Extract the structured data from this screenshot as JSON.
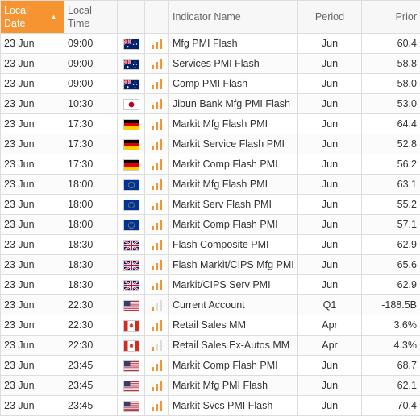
{
  "header": {
    "date": "Local Date",
    "time": "Local Time",
    "name": "Indicator Name",
    "period": "Period",
    "prior": "Prior"
  },
  "colors": {
    "accent": "#f79432",
    "bar_inactive": "#dddddd"
  },
  "rows": [
    {
      "date": "23 Jun",
      "time": "09:00",
      "flag": "AU",
      "name": "Mfg PMI Flash",
      "period": "Jun",
      "prior": "60.4",
      "importance": 3
    },
    {
      "date": "23 Jun",
      "time": "09:00",
      "flag": "AU",
      "name": "Services PMI Flash",
      "period": "Jun",
      "prior": "58.8",
      "importance": 3
    },
    {
      "date": "23 Jun",
      "time": "09:00",
      "flag": "AU",
      "name": "Comp PMI Flash",
      "period": "Jun",
      "prior": "58.0",
      "importance": 3
    },
    {
      "date": "23 Jun",
      "time": "10:30",
      "flag": "JP",
      "name": "Jibun Bank Mfg PMI Flash",
      "period": "Jun",
      "prior": "53.0",
      "importance": 3
    },
    {
      "date": "23 Jun",
      "time": "17:30",
      "flag": "DE",
      "name": "Markit Mfg Flash PMI",
      "period": "Jun",
      "prior": "64.4",
      "importance": 3
    },
    {
      "date": "23 Jun",
      "time": "17:30",
      "flag": "DE",
      "name": "Markit Service Flash PMI",
      "period": "Jun",
      "prior": "52.8",
      "importance": 3
    },
    {
      "date": "23 Jun",
      "time": "17:30",
      "flag": "DE",
      "name": "Markit Comp Flash PMI",
      "period": "Jun",
      "prior": "56.2",
      "importance": 3
    },
    {
      "date": "23 Jun",
      "time": "18:00",
      "flag": "EU",
      "name": "Markit Mfg Flash PMI",
      "period": "Jun",
      "prior": "63.1",
      "importance": 3
    },
    {
      "date": "23 Jun",
      "time": "18:00",
      "flag": "EU",
      "name": "Markit Serv Flash PMI",
      "period": "Jun",
      "prior": "55.2",
      "importance": 3
    },
    {
      "date": "23 Jun",
      "time": "18:00",
      "flag": "EU",
      "name": "Markit Comp Flash PMI",
      "period": "Jun",
      "prior": "57.1",
      "importance": 3
    },
    {
      "date": "23 Jun",
      "time": "18:30",
      "flag": "GB",
      "name": "Flash Composite PMI",
      "period": "Jun",
      "prior": "62.9",
      "importance": 3
    },
    {
      "date": "23 Jun",
      "time": "18:30",
      "flag": "GB",
      "name": "Flash Markit/CIPS Mfg PMI",
      "period": "Jun",
      "prior": "65.6",
      "importance": 3
    },
    {
      "date": "23 Jun",
      "time": "18:30",
      "flag": "GB",
      "name": "Markit/CIPS Serv PMI",
      "period": "Jun",
      "prior": "62.9",
      "importance": 3
    },
    {
      "date": "23 Jun",
      "time": "22:30",
      "flag": "US",
      "name": "Current Account",
      "period": "Q1",
      "prior": "-188.5B",
      "importance": 1
    },
    {
      "date": "23 Jun",
      "time": "22:30",
      "flag": "CA",
      "name": "Retail Sales MM",
      "period": "Apr",
      "prior": "3.6%",
      "importance": 3
    },
    {
      "date": "23 Jun",
      "time": "22:30",
      "flag": "CA",
      "name": "Retail Sales Ex-Autos MM",
      "period": "Apr",
      "prior": "4.3%",
      "importance": 1
    },
    {
      "date": "23 Jun",
      "time": "23:45",
      "flag": "US",
      "name": "Markit Comp Flash PMI",
      "period": "Jun",
      "prior": "68.7",
      "importance": 3
    },
    {
      "date": "23 Jun",
      "time": "23:45",
      "flag": "US",
      "name": "Markit Mfg PMI Flash",
      "period": "Jun",
      "prior": "62.1",
      "importance": 3
    },
    {
      "date": "23 Jun",
      "time": "23:45",
      "flag": "US",
      "name": "Markit Svcs PMI Flash",
      "period": "Jun",
      "prior": "70.4",
      "importance": 3
    }
  ]
}
